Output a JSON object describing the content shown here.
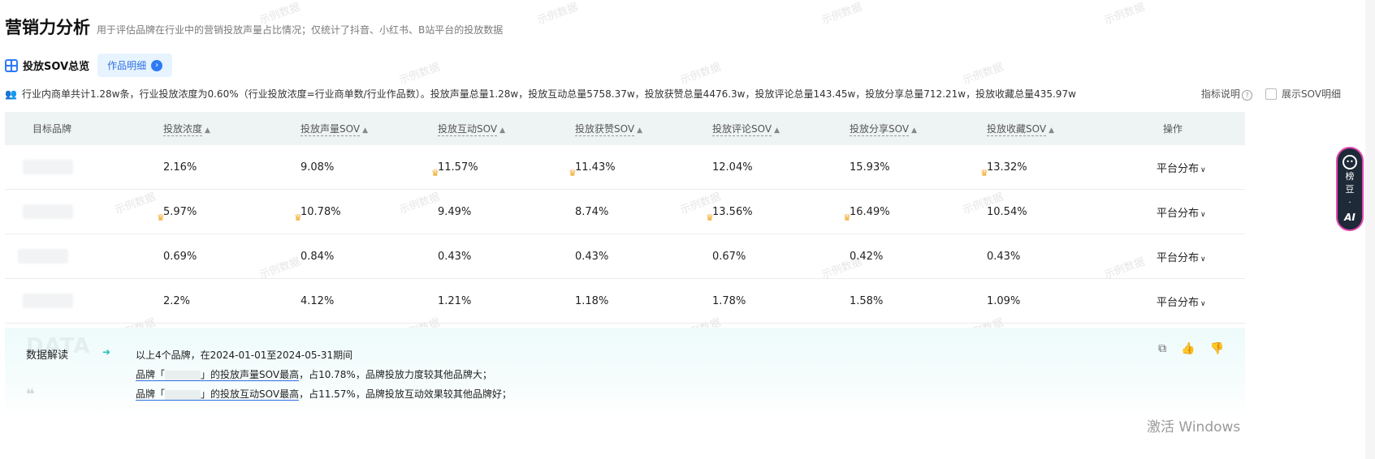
{
  "page": {
    "title": "营销力分析",
    "subtitle": "用于评估品牌在行业中的营销投放声量占比情况；仅统计了抖音、小红书、B站平台的投放数据"
  },
  "tabs": {
    "overview": "投放SOV总览",
    "detail": "作品明细"
  },
  "summary": {
    "text": "行业内商单共计1.28w条，行业投放浓度为0.60%（行业投放浓度=行业商单数/行业作品数）。投放声量总量1.28w，投放互动总量5758.37w，投放获赞总量4476.3w，投放评论总量143.45w，投放分享总量712.21w，投放收藏总量435.97w"
  },
  "controls": {
    "metric_help": "指标说明",
    "show_sov_detail": "展示SOV明细"
  },
  "table": {
    "headers": [
      "目标品牌",
      "投放浓度",
      "投放声量SOV",
      "投放互动SOV",
      "投放获赞SOV",
      "投放评论SOV",
      "投放分享SOV",
      "投放收藏SOV",
      "操作"
    ],
    "rows": [
      {
        "cells": [
          "2.16%",
          "9.08%",
          "11.57%",
          "11.43%",
          "12.04%",
          "15.93%",
          "13.32%"
        ],
        "op": "平台分布"
      },
      {
        "cells": [
          "5.97%",
          "10.78%",
          "9.49%",
          "8.74%",
          "13.56%",
          "16.49%",
          "10.54%"
        ],
        "op": "平台分布"
      },
      {
        "cells": [
          "0.69%",
          "0.84%",
          "0.43%",
          "0.43%",
          "0.67%",
          "0.42%",
          "0.43%"
        ],
        "op": "平台分布"
      },
      {
        "cells": [
          "2.2%",
          "4.12%",
          "1.21%",
          "1.18%",
          "1.78%",
          "1.58%",
          "1.09%"
        ],
        "op": "平台分布"
      }
    ]
  },
  "interpretation": {
    "label": "数据解读",
    "bg_text": "DATA",
    "line1": "以上4个品牌，在2024-01-01至2024-05-31期间",
    "line2_prefix": "品牌「",
    "line2_mid": "」的投放声量SOV最高",
    "line2_suffix": "，占10.78%，品牌投放力度较其他品牌大；",
    "line3_prefix": "品牌「",
    "line3_mid": "」的投放互动SOV最高",
    "line3_suffix": "，占11.57%，品牌投放互动效果较其他品牌好；"
  },
  "ai_badge": {
    "name_line1": "榜",
    "name_line2": "豆",
    "name_line3": "·",
    "ai": "AI"
  },
  "watermark": "示例数据",
  "os_overlay": "激活 Windows"
}
